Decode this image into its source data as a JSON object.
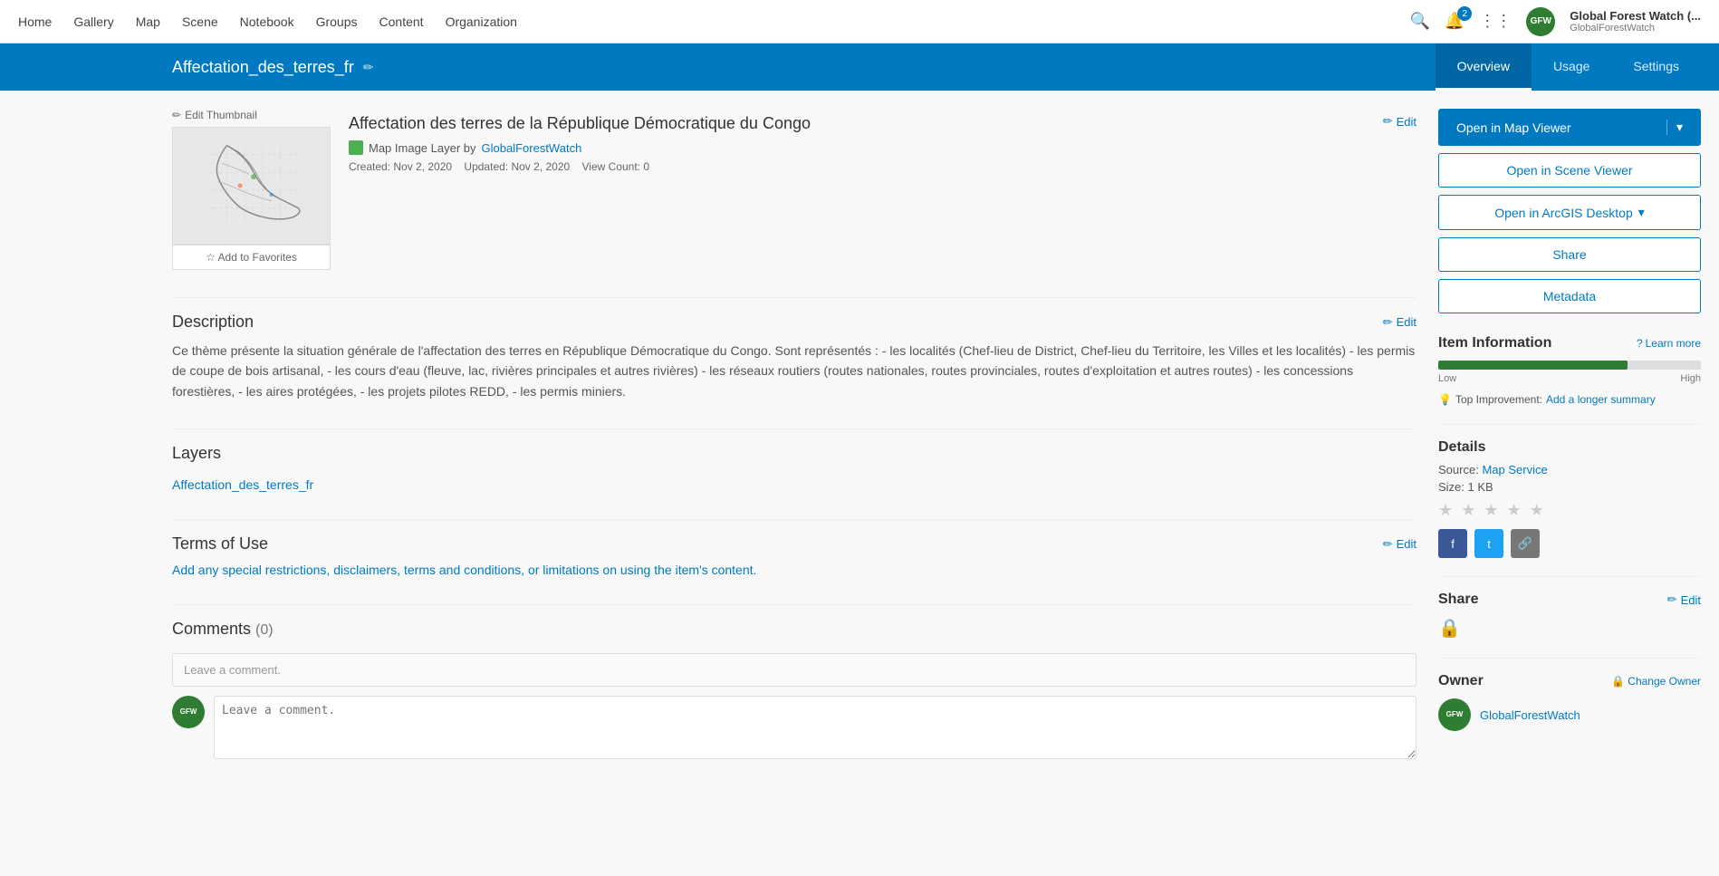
{
  "nav": {
    "links": [
      "Home",
      "Gallery",
      "Map",
      "Scene",
      "Notebook",
      "Groups",
      "Content",
      "Organization"
    ],
    "notification_count": "2",
    "user_display_name": "Global Forest Watch (...",
    "user_handle": "GlobalForestWatch",
    "user_avatar_text": "GFW"
  },
  "title_bar": {
    "page_title": "Affectation_des_terres_fr",
    "tabs": [
      "Overview",
      "Usage",
      "Settings"
    ],
    "active_tab": "Overview"
  },
  "item": {
    "full_title": "Affectation des terres de la République Démocratique du Congo",
    "type_label": "Map Image Layer by",
    "author_link": "GlobalForestWatch",
    "created": "Created: Nov 2, 2020",
    "updated": "Updated: Nov 2, 2020",
    "view_count": "View Count: 0",
    "edit_label": "Edit",
    "add_favorites": "Add to Favorites",
    "thumbnail_edit": "Edit Thumbnail"
  },
  "description": {
    "title": "Description",
    "edit_label": "Edit",
    "body": "Ce thème présente la situation générale de l'affectation des terres en République Démocratique du Congo. Sont représentés : - les localités (Chef-lieu de District, Chef-lieu du Territoire, les Villes et les localités) - les permis de coupe de bois artisanal, - les cours d'eau (fleuve, lac, rivières principales et autres rivières) - les réseaux routiers (routes nationales, routes provinciales, routes d'exploitation et autres routes) - les concessions forestières, - les aires protégées, - les projets pilotes REDD, - les permis miniers."
  },
  "layers": {
    "title": "Layers",
    "layer_name": "Affectation_des_terres_fr"
  },
  "terms_of_use": {
    "title": "Terms of Use",
    "edit_label": "Edit",
    "link_text": "Add any special restrictions, disclaimers, terms and conditions, or limitations on using the item's content."
  },
  "comments": {
    "title": "Comments",
    "count": "(0)",
    "placeholder1": "Leave a comment.",
    "placeholder2": "Leave a comment.",
    "avatar_text": "GFW"
  },
  "sidebar": {
    "open_map_viewer": "Open in Map Viewer",
    "open_scene_viewer": "Open in Scene Viewer",
    "open_arcgis_desktop": "Open in ArcGIS Desktop",
    "share_label": "Share",
    "metadata_label": "Metadata",
    "item_information_title": "Item Information",
    "learn_more": "Learn more",
    "progress_percent": 72,
    "progress_low": "Low",
    "progress_high": "High",
    "top_improvement_label": "Top Improvement:",
    "add_longer_summary": "Add a longer summary",
    "details_title": "Details",
    "source_label": "Source:",
    "source_link": "Map Service",
    "size_label": "Size: 1 KB",
    "share_section_title": "Share",
    "share_edit_label": "Edit",
    "owner_section_title": "Owner",
    "change_owner_label": "Change Owner",
    "owner_name": "GlobalForestWatch",
    "owner_avatar_text": "GFW"
  }
}
